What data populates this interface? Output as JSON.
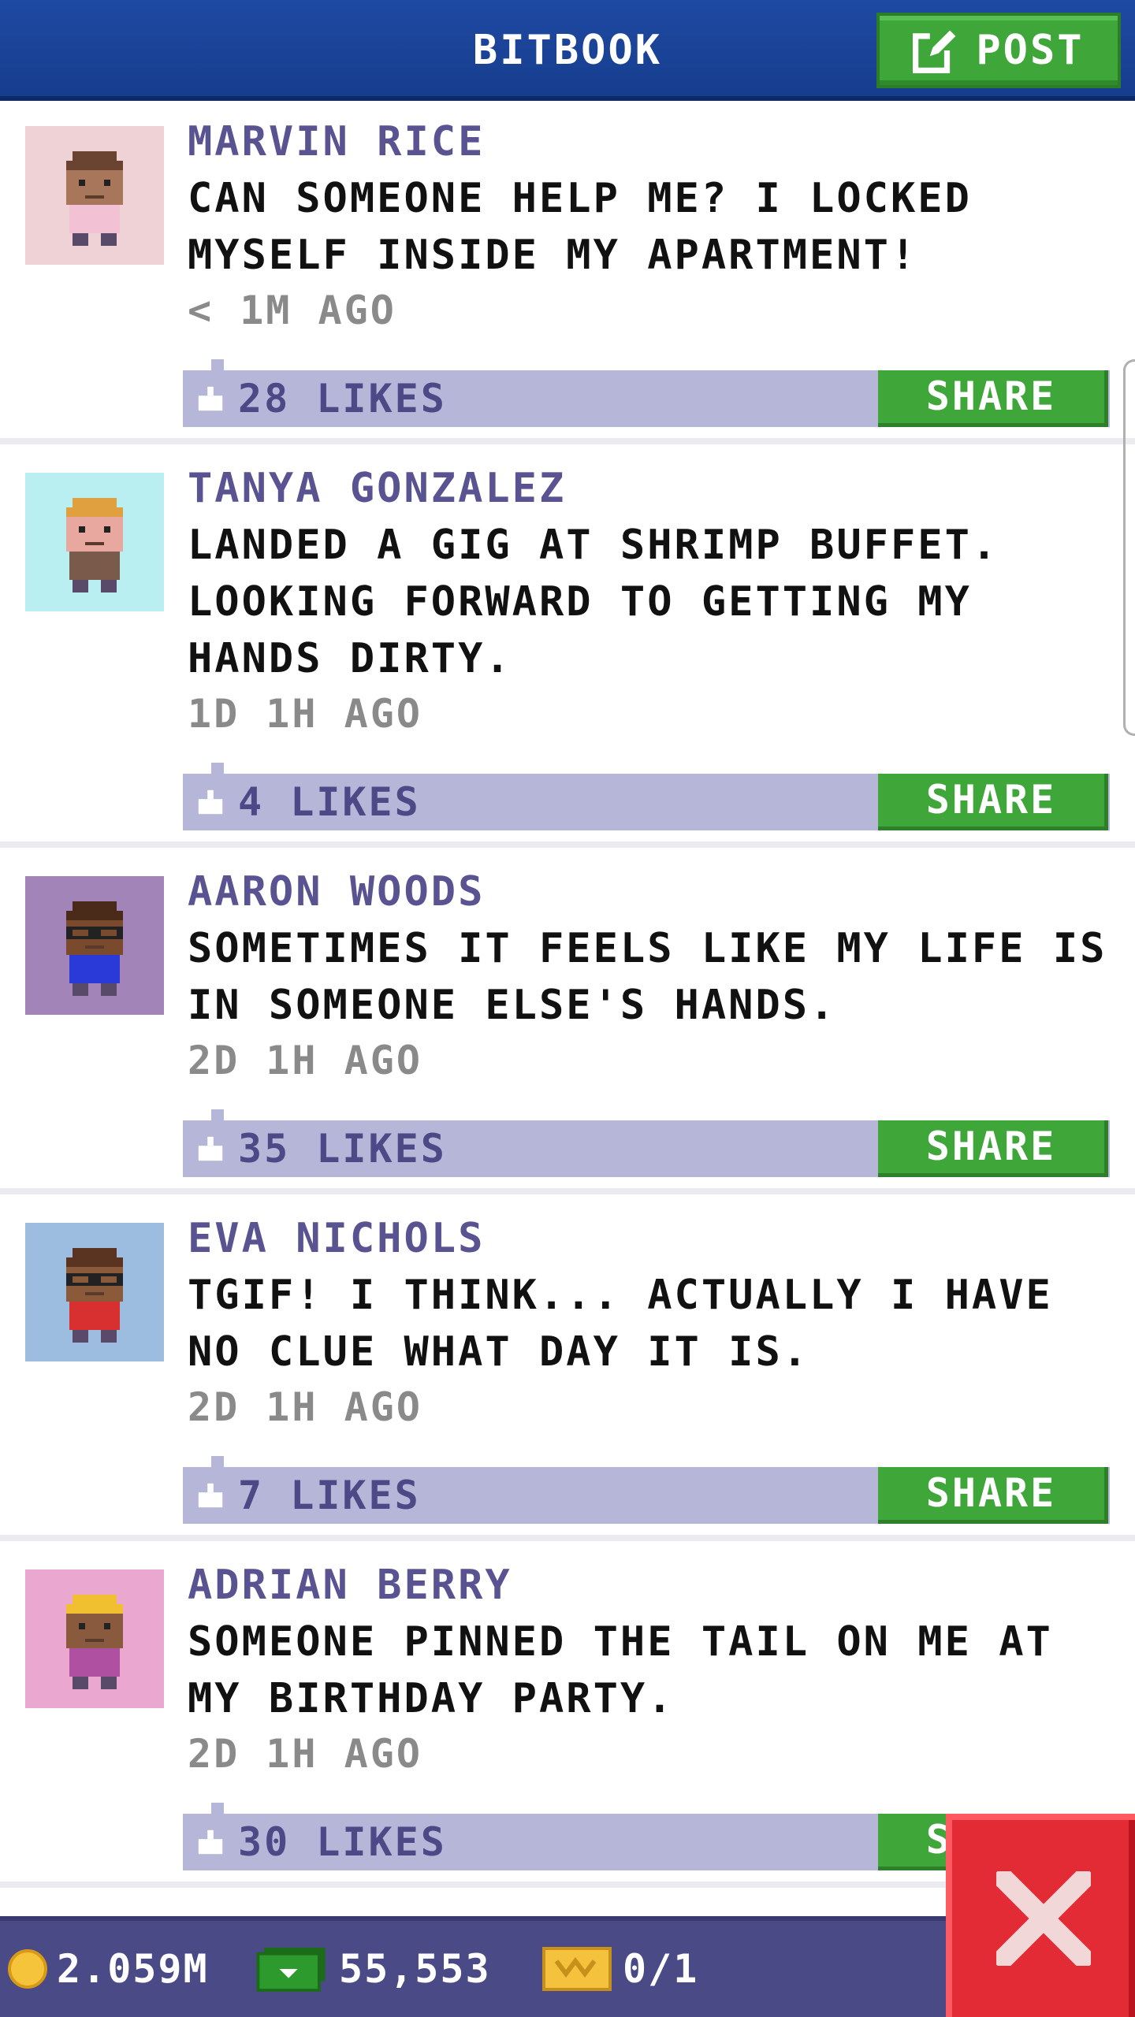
{
  "header": {
    "title": "BITBOOK",
    "post_label": "POST"
  },
  "posts": [
    {
      "author": "MARVIN RICE",
      "text": "CAN SOMEONE HELP ME? I LOCKED MYSELF INSIDE MY APARTMENT!",
      "time": "< 1M AGO",
      "likes": "28 LIKES",
      "share_label": "SHARE",
      "avatar_bg": "#efd2d6"
    },
    {
      "author": "TANYA GONZALEZ",
      "text": "LANDED A GIG AT SHRIMP BUFFET. LOOKING FORWARD TO GETTING MY HANDS DIRTY.",
      "time": "1D 1H AGO",
      "likes": "4 LIKES",
      "share_label": "SHARE",
      "avatar_bg": "#b9eff0"
    },
    {
      "author": "AARON WOODS",
      "text": "SOMETIMES IT FEELS LIKE MY LIFE IS IN SOMEONE ELSE'S HANDS.",
      "time": "2D 1H AGO",
      "likes": "35 LIKES",
      "share_label": "SHARE",
      "avatar_bg": "#a384b8"
    },
    {
      "author": "EVA NICHOLS",
      "text": "TGIF! I THINK... ACTUALLY I HAVE NO CLUE WHAT DAY IT IS.",
      "time": "2D 1H AGO",
      "likes": "7 LIKES",
      "share_label": "SHARE",
      "avatar_bg": "#9cbce0"
    },
    {
      "author": "ADRIAN BERRY",
      "text": "SOMEONE PINNED THE TAIL ON ME AT MY BIRTHDAY PARTY.",
      "time": "2D 1H AGO",
      "likes": "30 LIKES",
      "share_label": "SHARE",
      "avatar_bg": "#eaa8d0"
    }
  ],
  "status": {
    "coins": "2.059M",
    "bux": "55,553",
    "vip": "0/1"
  },
  "icons": {
    "post": "edit-icon",
    "like": "thumbs-up-icon",
    "coin": "coin-icon",
    "bux": "bux-icon",
    "vip": "vip-icon",
    "close": "close-icon"
  },
  "colors": {
    "header": "#1f4aa3",
    "accent_green": "#3fa63a",
    "like_bar": "#b6b6d8",
    "author": "#5a5392",
    "status_bar": "#4a4a86",
    "close": "#e32b35"
  }
}
